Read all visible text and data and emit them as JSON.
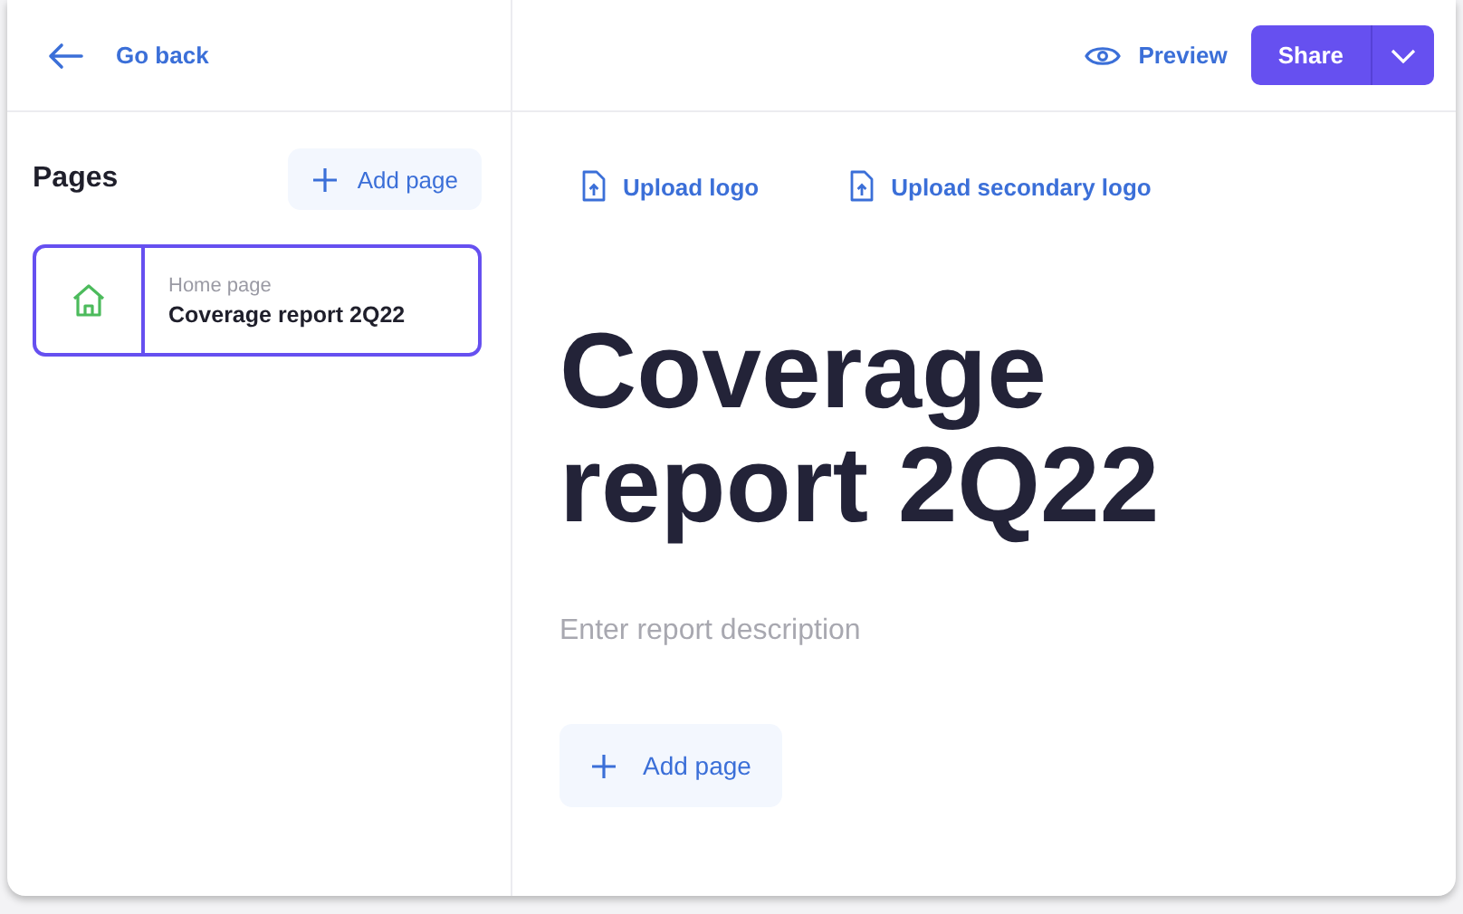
{
  "header": {
    "back": "Go back",
    "preview": "Preview",
    "share": "Share"
  },
  "sidebar": {
    "title": "Pages",
    "add_button": "Add page",
    "pages": [
      {
        "kind": "home",
        "label": "Home page",
        "title": "Coverage report 2Q22",
        "selected": true
      }
    ]
  },
  "editor": {
    "uploads": [
      "Upload logo",
      "Upload secondary logo"
    ],
    "title": "Coverage report 2Q22",
    "description": {
      "placeholder": "Enter report description"
    },
    "add_button": "Add page"
  }
}
